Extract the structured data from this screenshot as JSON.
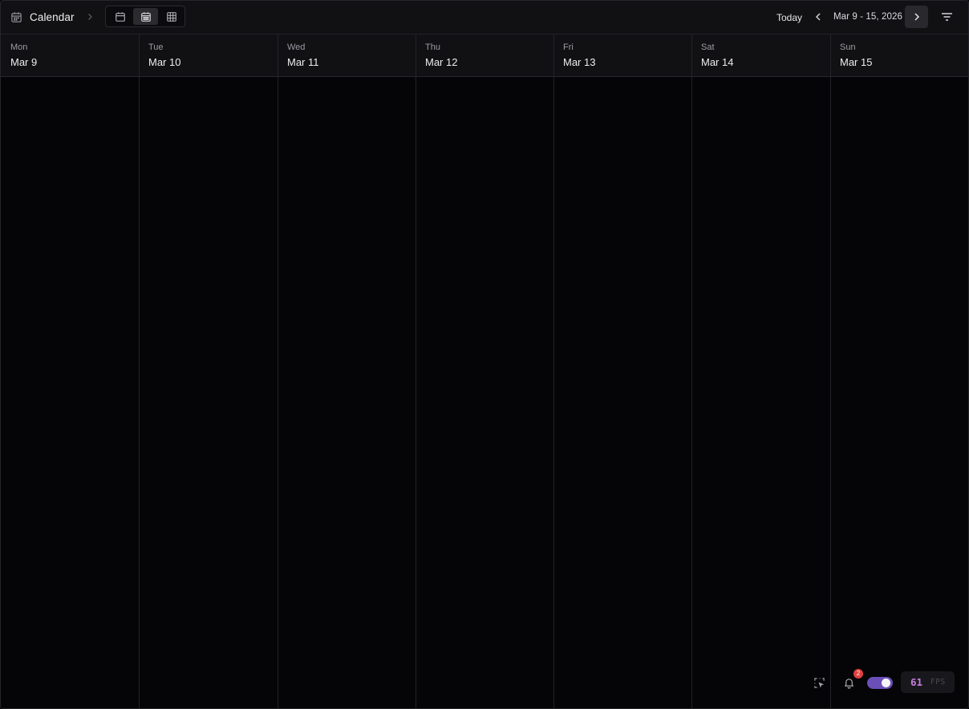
{
  "toolbar": {
    "title": "Calendar",
    "title_icon": "calendar-icon",
    "view_modes": [
      {
        "name": "day-view",
        "icon": "calendar-icon",
        "active": false
      },
      {
        "name": "week-view",
        "icon": "calendar-week-icon",
        "active": true
      },
      {
        "name": "month-view",
        "icon": "grid-icon",
        "active": false
      }
    ],
    "today_label": "Today",
    "date_range": "Mar 9 - 15, 2026",
    "prev_icon": "chevron-left-icon",
    "next_icon": "chevron-right-icon",
    "filter_icon": "filter-icon"
  },
  "days": [
    {
      "name": "Mon",
      "date": "Mar 9"
    },
    {
      "name": "Tue",
      "date": "Mar 10"
    },
    {
      "name": "Wed",
      "date": "Mar 11"
    },
    {
      "name": "Thu",
      "date": "Mar 12"
    },
    {
      "name": "Fri",
      "date": "Mar 13"
    },
    {
      "name": "Sat",
      "date": "Mar 14"
    },
    {
      "name": "Sun",
      "date": "Mar 15"
    }
  ],
  "dev_widget": {
    "notification_count": "2",
    "toggle_on": true,
    "fps_value": "61",
    "fps_label": "FPS",
    "accent_color": "#6b4fb8",
    "fps_color": "#c77dde",
    "badge_color": "#e0403d"
  }
}
